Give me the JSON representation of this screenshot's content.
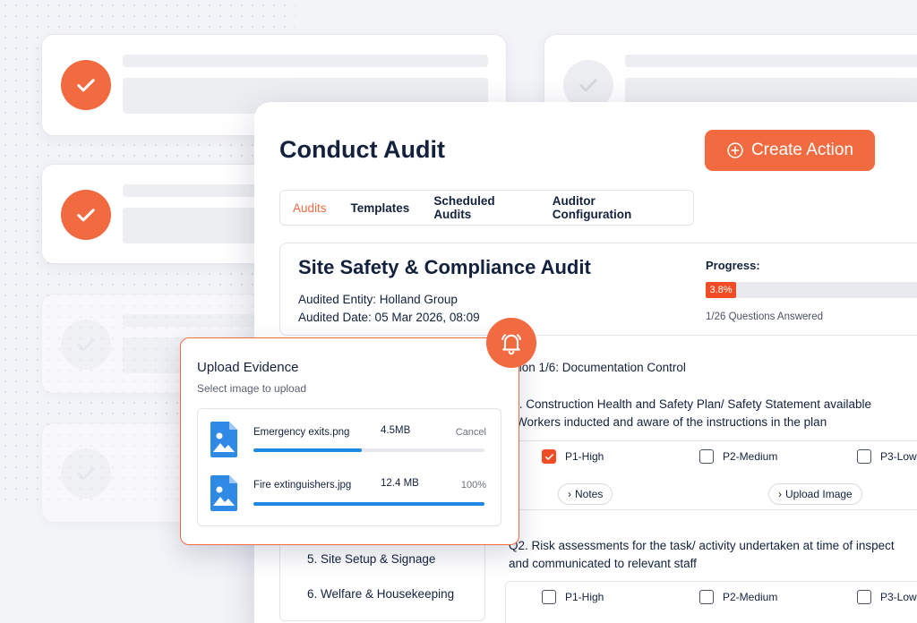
{
  "colors": {
    "accent": "#f26a3f",
    "progress": "#f24c24",
    "upload_bar": "#1e88e5"
  },
  "header": {
    "title": "Conduct Audit",
    "create_action_label": "Create Action",
    "create_action_icon": "plus-circle-icon"
  },
  "tabs": [
    {
      "label": "Audits",
      "active": true
    },
    {
      "label": "Templates",
      "active": false
    },
    {
      "label": "Scheduled Audits",
      "active": false
    },
    {
      "label": "Auditor Configuration",
      "active": false
    }
  ],
  "audit": {
    "title": "Site Safety & Compliance Audit",
    "entity": "Audited Entity: Holland Group",
    "date": "Audited Date: 05 Mar 2026, 08:09",
    "progress_label": "Progress:",
    "progress_value": "3.8%",
    "progress_fraction": 0.038,
    "questions_answered": "1/26 Questions Answered"
  },
  "section_title": "tion 1/6: Documentation Control",
  "q1": {
    "line1": "I. Construction Health and Safety Plan/ Safety Statement available",
    "line2": "Workers inducted and aware of the instructions in the plan",
    "options": [
      {
        "label": "P1-High",
        "checked": true
      },
      {
        "label": "P2-Medium",
        "checked": false
      },
      {
        "label": "P3-Low",
        "checked": false
      }
    ],
    "notes_label": "Notes",
    "upload_label": "Upload Image"
  },
  "q2": {
    "line1": "Q2. Risk assessments for the task/ activity undertaken at time of inspect",
    "line2": "and communicated to relevant staff",
    "options": [
      {
        "label": "P1-High",
        "checked": false
      },
      {
        "label": "P2-Medium",
        "checked": false
      },
      {
        "label": "P3-Low",
        "checked": false
      }
    ]
  },
  "sections_list": [
    {
      "label": "5. Site Setup & Signage"
    },
    {
      "label": "6. Welfare & Housekeeping"
    }
  ],
  "upload": {
    "title": "Upload Evidence",
    "subtitle": "Select image to upload",
    "files": [
      {
        "name": "Emergency exits.png",
        "size": "4.5MB",
        "status": "Cancel",
        "progress": 0.47
      },
      {
        "name": "Fire extinguishers.jpg",
        "size": "12.4 MB",
        "status": "100%",
        "progress": 1.0
      }
    ]
  }
}
